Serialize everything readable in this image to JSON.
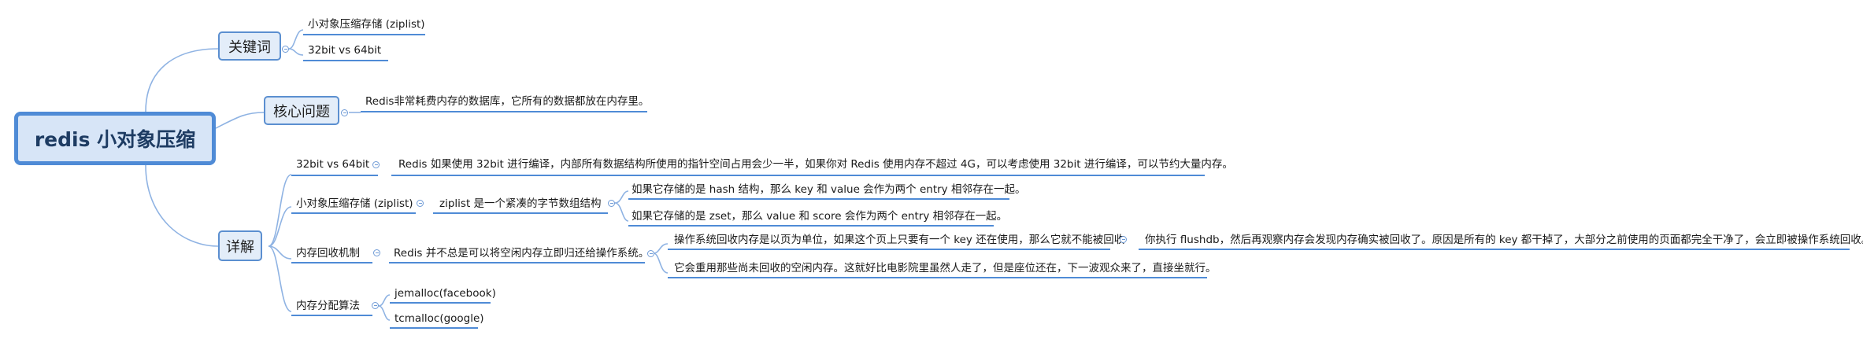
{
  "root": "redis 小对象压缩",
  "branches": {
    "keywords": {
      "title": "关键词",
      "items": [
        "小对象压缩存储 (ziplist)",
        "32bit vs 64bit"
      ]
    },
    "core": {
      "title": "核心问题",
      "text": "Redis非常耗费内存的数据库，它所有的数据都放在内存里。"
    },
    "detail": {
      "title": "详解",
      "bit": {
        "label": "32bit vs 64bit",
        "text": "Redis 如果使用 32bit 进行编译，内部所有数据结构所使用的指针空间占用会少一半，如果你对 Redis 使用内存不超过 4G，可以考虑使用 32bit 进行编译，可以节约大量内存。"
      },
      "ziplist": {
        "label": "小对象压缩存储 (ziplist)",
        "desc": "ziplist 是一个紧凑的字节数组结构",
        "items": [
          "如果它存储的是 hash 结构，那么 key 和 value 会作为两个 entry 相邻存在一起。",
          "如果它存储的是 zset，那么 value 和 score 会作为两个 entry 相邻存在一起。"
        ]
      },
      "recycle": {
        "label": "内存回收机制",
        "desc": "Redis 并不总是可以将空闲内存立即归还给操作系统。",
        "items": [
          "操作系统回收内存是以页为单位，如果这个页上只要有一个 key 还在使用，那么它就不能被回收",
          "它会重用那些尚未回收的空闲内存。这就好比电影院里虽然人走了，但是座位还在，下一波观众来了，直接坐就行。"
        ],
        "sub": "你执行 flushdb，然后再观察内存会发现内存确实被回收了。原因是所有的 key 都干掉了，大部分之前使用的页面都完全干净了，会立即被操作系统回收。"
      },
      "alloc": {
        "label": "内存分配算法",
        "items": [
          "jemalloc(facebook)",
          "tcmalloc(google)"
        ]
      }
    }
  }
}
